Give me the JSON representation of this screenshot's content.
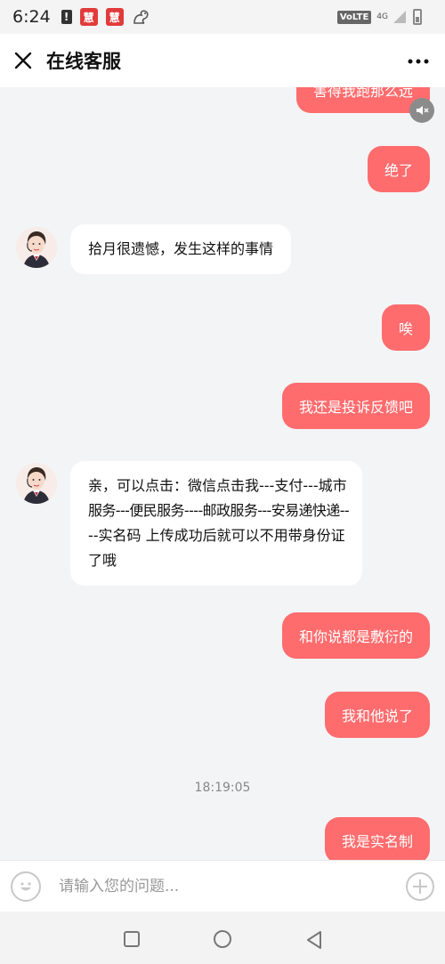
{
  "status_bar": {
    "time": "6:24",
    "alert_icon": "!",
    "app_icon_1": "慧",
    "app_icon_2": "慧",
    "volte": "VoLTE",
    "network": "4G"
  },
  "header": {
    "title": "在线客服",
    "close_icon": "close-icon",
    "more_icon": "more-icon"
  },
  "messages": [
    {
      "side": "right",
      "text": "害得我跑那么远"
    },
    {
      "side": "right",
      "text": "绝了"
    },
    {
      "side": "left",
      "text": "拾月很遗憾，发生这样的事情"
    },
    {
      "side": "right",
      "text": "唉"
    },
    {
      "side": "right",
      "text": "我还是投诉反馈吧"
    },
    {
      "side": "left",
      "lines": [
        "亲，可以点击：微信点击我---支付---城市",
        "服务---便民服务----邮政服务---安易递快递--",
        "--实名码 上传成功后就可以不用带身份证",
        "了哦"
      ]
    },
    {
      "side": "right",
      "text": "和你说都是敷衍的"
    },
    {
      "side": "right",
      "text": "我和他说了"
    },
    {
      "side": "right",
      "text": "我是实名制"
    }
  ],
  "timestamp": "18:19:05",
  "input": {
    "placeholder": "请输入您的问题..."
  },
  "colors": {
    "accent": "#fe6c6e",
    "background": "#f3f4f6",
    "agent_bubble": "#ffffff"
  }
}
